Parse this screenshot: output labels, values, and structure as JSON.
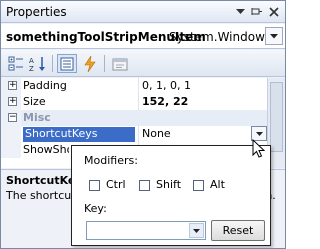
{
  "window": {
    "title": "Properties"
  },
  "object_selector": {
    "name": "somethingToolStripMenuItem",
    "type": "System.Windows"
  },
  "toolbar": {
    "icons": [
      "categorized-icon",
      "alphabetical-icon",
      "properties-icon",
      "events-icon",
      "property-pages-icon"
    ],
    "active": "properties-icon"
  },
  "grid": {
    "rows": [
      {
        "kind": "property",
        "expander": "+",
        "name": "Padding",
        "value": "0, 1, 0, 1",
        "bold": false
      },
      {
        "kind": "property",
        "expander": "+",
        "name": "Size",
        "value": "152, 22",
        "bold": true
      },
      {
        "kind": "category",
        "expander": "−",
        "name": "Misc",
        "value": ""
      },
      {
        "kind": "property",
        "expander": "",
        "name": "ShortcutKeys",
        "value": "None",
        "selected": true
      },
      {
        "kind": "property",
        "expander": "",
        "name": "ShowShortcutKeys",
        "value": ""
      }
    ]
  },
  "description": {
    "title": "ShortcutKeys",
    "text": "The shortcut key associated with the menu item."
  },
  "shortcut_editor": {
    "modifiers_label": "Modifiers:",
    "ctrl_label": "Ctrl",
    "shift_label": "Shift",
    "alt_label": "Alt",
    "ctrl_checked": false,
    "shift_checked": false,
    "alt_checked": false,
    "key_label": "Key:",
    "key_value": "",
    "reset_label": "Reset"
  },
  "colors": {
    "selection": "#3b6cc7",
    "category_text": "#8c97ab",
    "frame": "#7a8aa6"
  }
}
